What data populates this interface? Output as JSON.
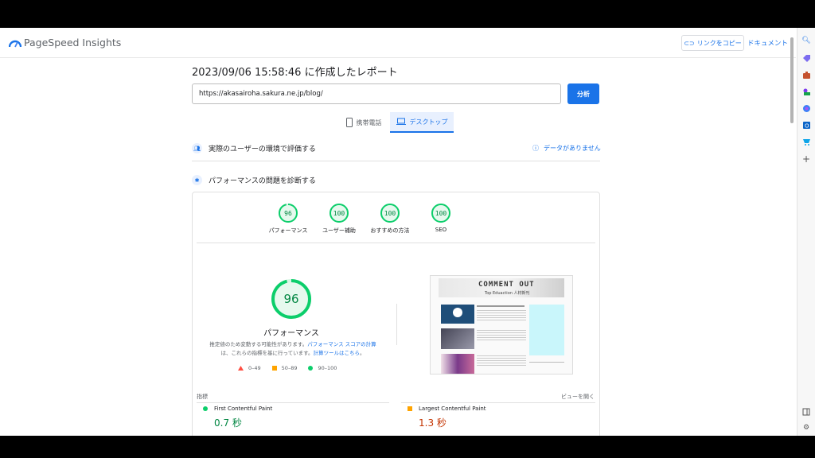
{
  "header": {
    "app_name": "PageSpeed Insights",
    "copy_link_label": "リンクをコピー",
    "docs_label": "ドキュメント"
  },
  "report": {
    "title": "2023/09/06 15:58:46 に作成したレポート",
    "url_value": "https://akasairoha.sakura.ne.jp/blog/",
    "analyze_label": "分析"
  },
  "tabs": {
    "mobile_label": "携帯電話",
    "desktop_label": "デスクトップ"
  },
  "sections": {
    "field_data_title": "実際のユーザーの環境で評価する",
    "no_data_label": "データがありません",
    "diagnose_title": "パフォーマンスの問題を診断する"
  },
  "scores": [
    {
      "label": "パフォーマンス",
      "value": "96"
    },
    {
      "label": "ユーザー補助",
      "value": "100"
    },
    {
      "label": "おすすめの方法",
      "value": "100"
    },
    {
      "label": "SEO",
      "value": "100"
    }
  ],
  "performance": {
    "score": "96",
    "label": "パフォーマンス",
    "note_prefix": "推定値のため変動する可能性があります。",
    "note_link1": "パフォーマンス スコアの計算",
    "note_mid": "は、これらの指標を基に行っています。",
    "note_link2": "計算ツールはこちら",
    "note_end": "。"
  },
  "legend": {
    "poor": "0–49",
    "average": "50–89",
    "good": "90–100"
  },
  "metrics": {
    "heading": "指標",
    "expand_label": "ビューを開く",
    "items": [
      {
        "name": "First Contentful Paint",
        "value": "0.7 秒",
        "status_color": "#0cce6b"
      },
      {
        "name": "Largest Contentful Paint",
        "value": "1.3 秒",
        "status_color": "#ffa400"
      }
    ]
  },
  "screenshot": {
    "site_title": "COMMENT OUT",
    "site_subtitle": "Top Eduaction 人材新刊"
  },
  "colors": {
    "accent": "#1a73e8",
    "good": "#0cce6b",
    "average": "#ffa400",
    "poor": "#ff4e42",
    "good_text": "#018642",
    "average_text": "#c33300"
  }
}
